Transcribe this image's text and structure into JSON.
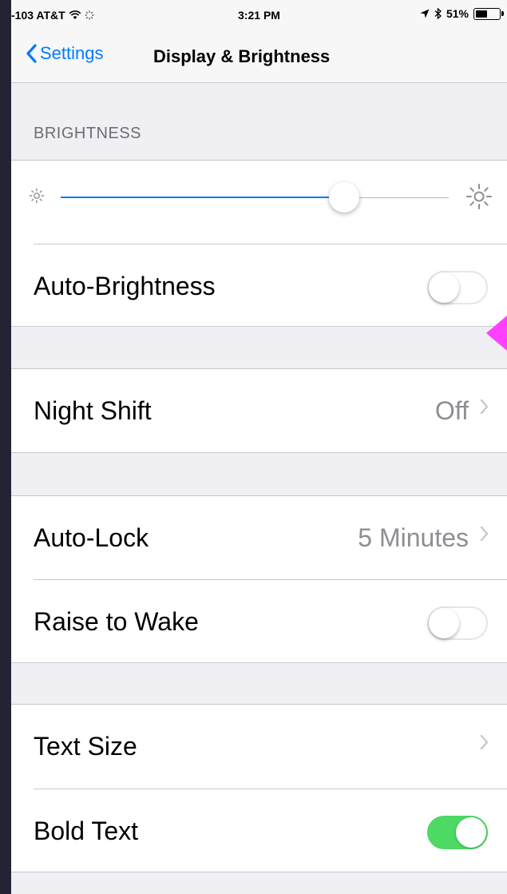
{
  "status": {
    "carrier": "-103 AT&T",
    "time": "3:21 PM",
    "battery": "51%",
    "battery_level": 0.51
  },
  "nav": {
    "back_label": "Settings",
    "title": "Display & Brightness"
  },
  "brightness": {
    "header": "BRIGHTNESS",
    "slider_value": 0.73,
    "auto_brightness_label": "Auto-Brightness",
    "auto_brightness_on": false
  },
  "night_shift": {
    "label": "Night Shift",
    "value": "Off"
  },
  "lock": {
    "auto_lock_label": "Auto-Lock",
    "auto_lock_value": "5 Minutes",
    "raise_to_wake_label": "Raise to Wake",
    "raise_to_wake_on": false
  },
  "text": {
    "text_size_label": "Text Size",
    "bold_text_label": "Bold Text",
    "bold_text_on": true
  },
  "colors": {
    "accent": "#007aff",
    "toggle_on": "#4cd964",
    "annotation_arrow": "#ff40ff"
  },
  "icons": [
    "wifi-icon",
    "activity-spinner-icon",
    "location-arrow-icon",
    "bluetooth-icon",
    "battery-icon",
    "back-chevron-icon",
    "sun-small-icon",
    "sun-large-icon",
    "chevron-right-icon"
  ]
}
